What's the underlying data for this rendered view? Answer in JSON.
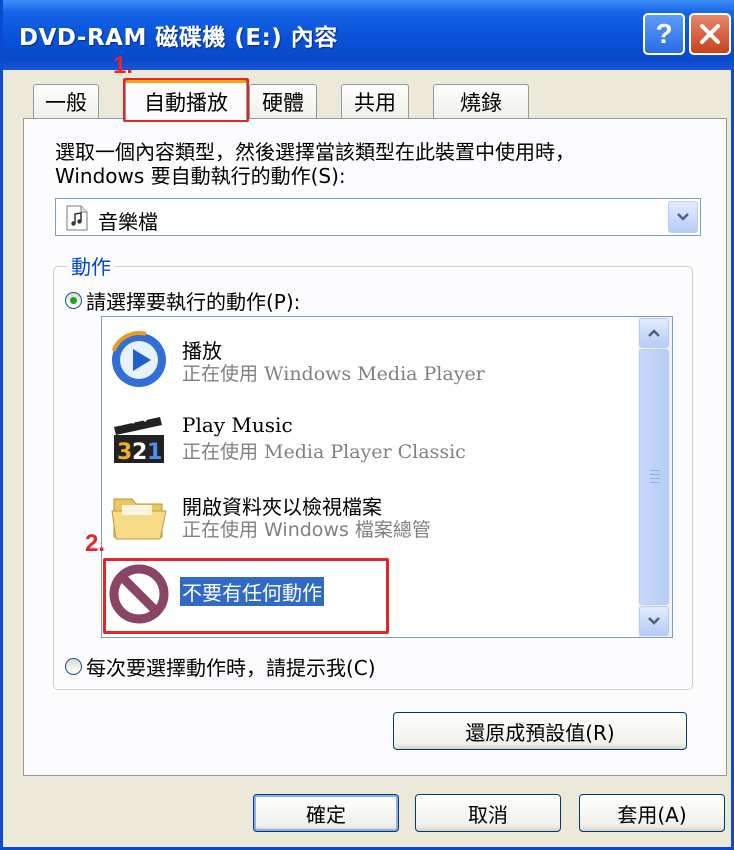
{
  "window": {
    "title": "DVD-RAM 磁碟機 (E:) 內容"
  },
  "tabs": [
    {
      "label": "一般"
    },
    {
      "label": "自動播放"
    },
    {
      "label": "硬體"
    },
    {
      "label": "共用"
    },
    {
      "label": "燒錄"
    }
  ],
  "autoplay": {
    "intro_line1": "選取一個內容類型，然後選擇當該類型在此裝置中使用時，",
    "intro_line2": "Windows 要自動執行的動作(S):",
    "content_type": "音樂檔",
    "group_label": "動作",
    "radio_select_action": "請選擇要執行的動作(P):",
    "radio_prompt": "每次要選擇動作時，請提示我(C)",
    "actions": [
      {
        "name": "播放",
        "app_prefix": "正在使用 ",
        "app": "Windows Media Player",
        "icon": "windows-media-player-icon"
      },
      {
        "name": "Play Music",
        "app_prefix": "正在使用 ",
        "app": "Media Player Classic",
        "icon": "media-player-classic-icon"
      },
      {
        "name": "開啟資料夾以檢視檔案",
        "app_prefix": "正在使用 ",
        "app": "Windows 檔案總管",
        "icon": "folder-icon"
      },
      {
        "name": "不要有任何動作",
        "icon": "no-action-icon"
      }
    ],
    "restore_defaults_label": "還原成預設值(R)"
  },
  "footer": {
    "ok_label": "確定",
    "cancel_label": "取消",
    "apply_label": "套用(A)"
  },
  "annotations": {
    "step1": "1.",
    "step2": "2."
  },
  "colors": {
    "titlebar": "#0752d6",
    "selection": "#316ac5",
    "annotation_red": "#e5252a",
    "group_label_blue": "#0046d5"
  }
}
